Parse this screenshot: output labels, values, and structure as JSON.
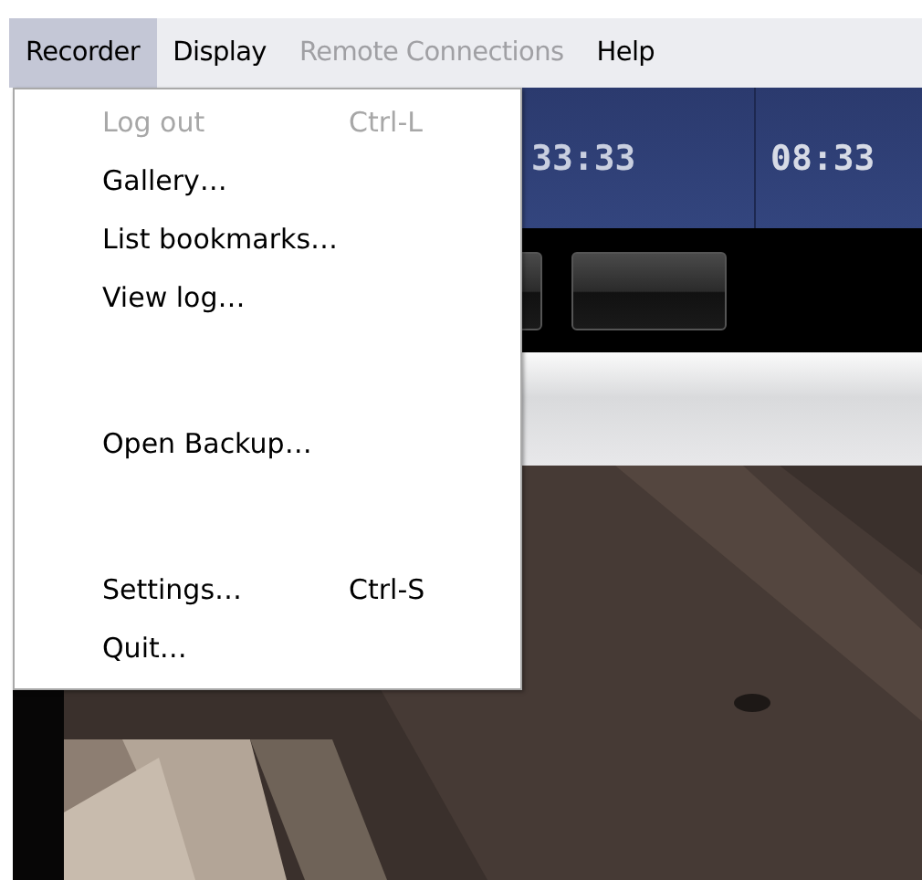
{
  "menu_bar": [
    {
      "label": "Recorder",
      "selected": true,
      "disabled": false
    },
    {
      "label": "Display",
      "selected": false,
      "disabled": false
    },
    {
      "label": "Remote Connections",
      "selected": false,
      "disabled": true
    },
    {
      "label": "Help",
      "selected": false,
      "disabled": false
    }
  ],
  "recorder_menu": [
    {
      "kind": "item",
      "label": "Log out",
      "shortcut": "Ctrl-L",
      "disabled": true
    },
    {
      "kind": "item",
      "label": "Gallery…",
      "disabled": false
    },
    {
      "kind": "item",
      "label": "List bookmarks…",
      "disabled": false
    },
    {
      "kind": "item",
      "label": "View log…",
      "disabled": false
    },
    {
      "kind": "spacer"
    },
    {
      "kind": "item",
      "label": "Open Backup…",
      "disabled": false
    },
    {
      "kind": "spacer"
    },
    {
      "kind": "item",
      "label": "Settings…",
      "shortcut": "Ctrl-S",
      "disabled": false
    },
    {
      "kind": "item",
      "label": "Quit…",
      "disabled": false
    }
  ],
  "timeline": {
    "times": [
      "33:33",
      "08:33"
    ]
  }
}
